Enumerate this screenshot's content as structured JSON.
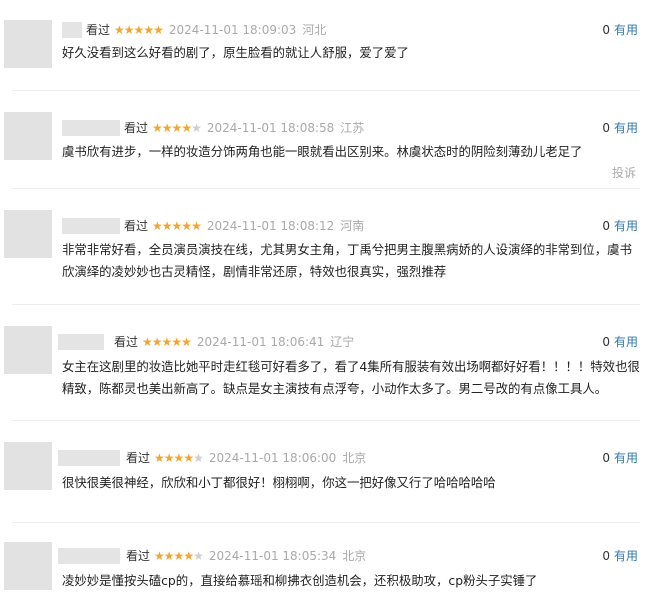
{
  "useful_label": "有用",
  "kanguo": "看过",
  "report_label": "投诉",
  "reviews": [
    {
      "rating": 5,
      "time": "2024-11-01 18:09:03",
      "location": "河北",
      "useful": "0",
      "text": "好久没看到这么好看的剧了，原生脸看的就让人舒服，爱了爱了"
    },
    {
      "rating": 4,
      "time": "2024-11-01 18:08:58",
      "location": "江苏",
      "useful": "0",
      "text": "虞书欣有进步，一样的妆造分饰两角也能一眼就看出区别来。林虞状态时的阴险刻薄劲儿老足了"
    },
    {
      "rating": 5,
      "time": "2024-11-01 18:08:12",
      "location": "河南",
      "useful": "0",
      "text": "非常非常好看，全员演员演技在线，尤其男女主角，丁禹兮把男主腹黑病娇的人设演绎的非常到位，虞书欣演绎的凌妙妙也古灵精怪，剧情非常还原，特效也很真实，强烈推荐"
    },
    {
      "rating": 5,
      "time": "2024-11-01 18:06:41",
      "location": "辽宁",
      "useful": "0",
      "text": "女主在这剧里的妆造比她平时走红毯可好看多了，看了4集所有服装有效出场啊都好好看！！！！特效也很精致，陈都灵也美出新高了。缺点是女主演技有点浮夸，小动作太多了。男二号改的有点像工具人。"
    },
    {
      "rating": 4,
      "time": "2024-11-01 18:06:00",
      "location": "北京",
      "useful": "0",
      "text": "很快很美很神经，欣欣和小丁都很好！栩栩啊，你这一把好像又行了哈哈哈哈哈"
    },
    {
      "rating": 4,
      "time": "2024-11-01 18:05:34",
      "location": "北京",
      "useful": "0",
      "text": "凌妙妙是懂按头磕cp的，直接给慕瑶和柳拂衣创造机会，还积极助攻，cp粉头子实锤了"
    }
  ]
}
